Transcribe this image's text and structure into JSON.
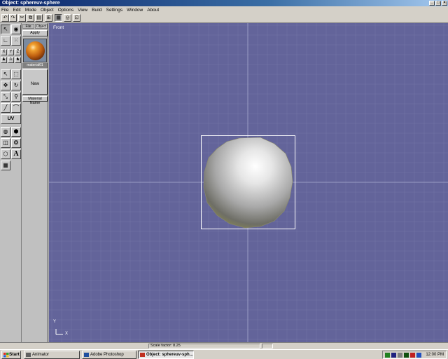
{
  "window": {
    "title": "Object: sphereuv-sphere",
    "controls": [
      "_",
      "□",
      "×"
    ]
  },
  "menu": [
    "File",
    "Edit",
    "Mode",
    "Object",
    "Options",
    "View",
    "Build",
    "Settings",
    "Window",
    "About"
  ],
  "material_panel": {
    "tabs": [
      "File",
      "Object"
    ],
    "apply_label": "Apply",
    "material_name": "material01",
    "new_label": "New",
    "material_name_button": "Material Name"
  },
  "tools": {
    "uv_label": "UV",
    "text_label": "A",
    "axis_buttons": [
      "X",
      "Y",
      "Z"
    ]
  },
  "viewport": {
    "label": "Front",
    "axis_y": "Y",
    "axis_x": "X",
    "background": "#63649a",
    "grid_color": "#7576a6",
    "crosshair_color": "#9a9bc4"
  },
  "status": {
    "scale_text": "Scale factor: 8.25"
  },
  "taskbar": {
    "start_label": "Start",
    "tasks": [
      {
        "label": "Animator",
        "active": false
      },
      {
        "label": "Adobe Photoshop",
        "active": false
      },
      {
        "label": "Object: sphereuv-sph...",
        "active": true
      }
    ],
    "clock": "12:00 PM"
  }
}
